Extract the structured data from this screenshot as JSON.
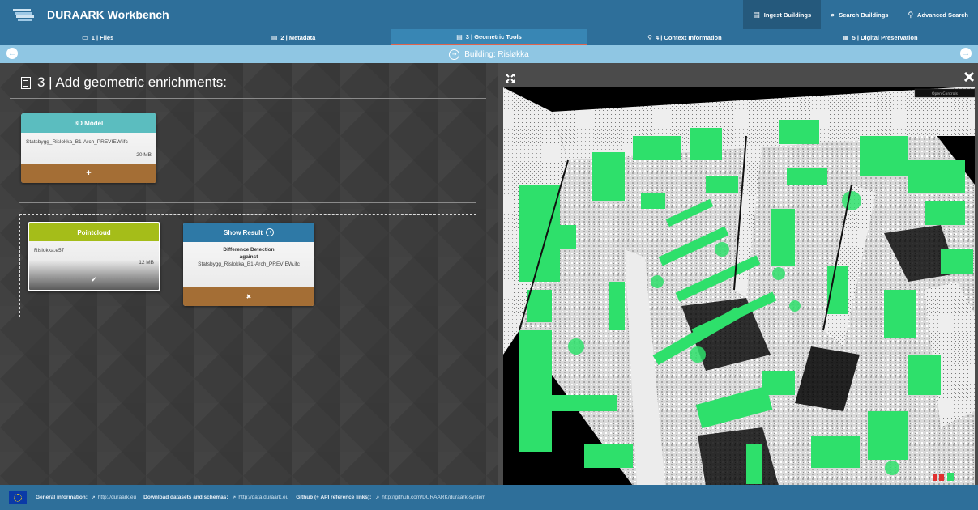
{
  "app": {
    "title": "DURAARK Workbench"
  },
  "topnav": [
    {
      "label": "Ingest Buildings",
      "icon": "▤",
      "active": true
    },
    {
      "label": "Search Buildings",
      "icon": "🔭",
      "active": false
    },
    {
      "label": "Advanced Search",
      "icon": "⚲",
      "active": false
    }
  ],
  "steps": [
    {
      "label": "1 | Files",
      "icon": "▭",
      "active": false
    },
    {
      "label": "2 | Metadata",
      "icon": "▤",
      "active": false
    },
    {
      "label": "3 | Geometric Tools",
      "icon": "▤",
      "active": true
    },
    {
      "label": "4 | Context Information",
      "icon": "⚲",
      "active": false
    },
    {
      "label": "5 | Digital Preservation",
      "icon": "▦",
      "active": false
    }
  ],
  "building": {
    "label": "Building: Rislokka",
    "display": "Building: Risløkka"
  },
  "main": {
    "title": "3 | Add geometric enrichments:"
  },
  "model_card": {
    "header": "3D Model",
    "filename": "Statsbygg_Rislokka_B1-Arch_PREVIEW.ifc",
    "size": "20 MB",
    "action": "+",
    "header_color": "#5bbdbf",
    "footer_color": "#a46e35"
  },
  "pointcloud_card": {
    "header": "Pointcloud",
    "filename": "Rislokka.e57",
    "size": "12 MB",
    "action": "✔",
    "header_color": "#a5bd19"
  },
  "result_card": {
    "header": "Show Result",
    "header_icon": "➔",
    "line1": "Difference Detection",
    "line2": "against",
    "line3": "Statsbygg_Rislokka_B1-Arch_PREVIEW.ifc",
    "action": "✖",
    "header_color": "#2e79a6"
  },
  "viewer": {
    "expand_icon": "expand-icon",
    "close_icon": "close-icon",
    "small_label": "Open Controls"
  },
  "footer": {
    "general_label": "General information:",
    "general_link": "http://duraark.eu",
    "datasets_label": "Download datasets and schemas:",
    "datasets_link": "http://data.duraark.eu",
    "github_label": "Github (+ API reference links):",
    "github_link": "http://github.com/DURAARK/duraark-system"
  }
}
